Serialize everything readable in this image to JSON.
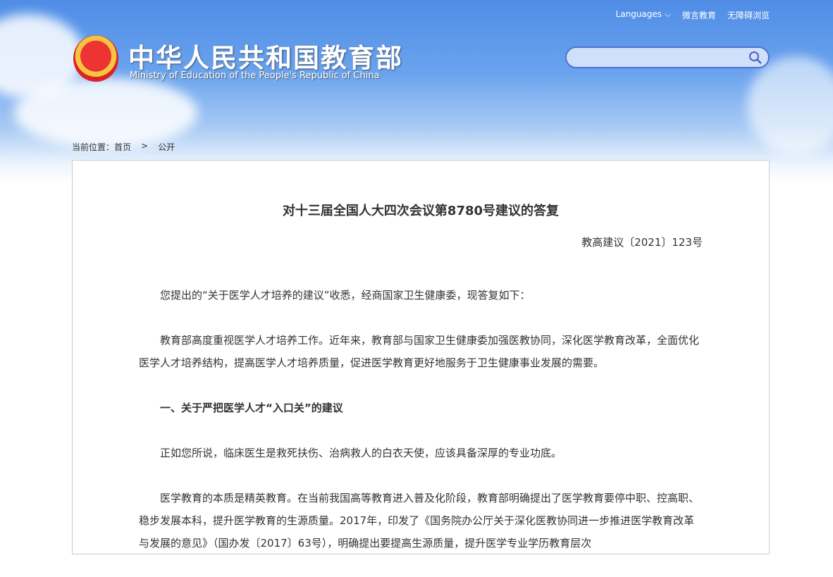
{
  "header": {
    "languages": "Languages",
    "weiyan": "微言教育",
    "accessibility": "无障碍浏览",
    "logo_cn": "中华人民共和国教育部",
    "logo_en": "Ministry of Education of the People's Republic of China",
    "search_placeholder": ""
  },
  "breadcrumb": {
    "label": "当前位置：",
    "home": "首页",
    "sep": ">",
    "current": "公开"
  },
  "article": {
    "title": "对十三届全国人大四次会议第8780号建议的答复",
    "doc_no": "教高建议〔2021〕123号",
    "paragraphs": [
      "您提出的“关于医学人才培养的建议”收悉，经商国家卫生健康委，现答复如下：",
      "教育部高度重视医学人才培养工作。近年来，教育部与国家卫生健康委加强医教协同，深化医学教育改革，全面优化医学人才培养结构，提高医学人才培养质量，促进医学教育更好地服务于卫生健康事业发展的需要。",
      "一、关于严把医学人才“入口关”的建议",
      "正如您所说，临床医生是救死扶伤、治病救人的白衣天使，应该具备深厚的专业功底。",
      "医学教育的本质是精英教育。在当前我国高等教育进入普及化阶段，教育部明确提出了医学教育要停中职、控高职、稳步发展本科，提升医学教育的生源质量。2017年，印发了《国务院办公厅关于深化医教协同进一步推进医学教育改革与发展的意见》（国办发〔2017〕63号），明确提出要提高生源质量，提升医学专业学历教育层次"
    ]
  }
}
